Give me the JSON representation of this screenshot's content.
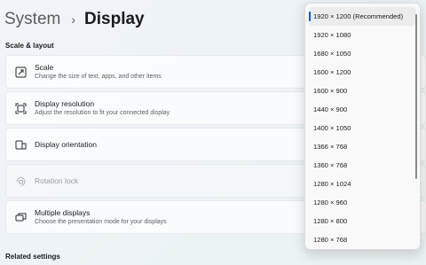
{
  "breadcrumb": {
    "parent": "System",
    "separator": "›",
    "current": "Display"
  },
  "sections": {
    "scale_layout": "Scale & layout",
    "related": "Related settings"
  },
  "cards": [
    {
      "title": "Scale",
      "subtitle": "Change the size of text, apps, and other items",
      "icon": "scale-icon"
    },
    {
      "title": "Display resolution",
      "subtitle": "Adjust the resolution to fit your connected display",
      "icon": "resolution-icon"
    },
    {
      "title": "Display orientation",
      "subtitle": "",
      "icon": "orientation-icon"
    },
    {
      "title": "Rotation lock",
      "subtitle": "",
      "icon": "rotation-lock-icon",
      "disabled": true
    },
    {
      "title": "Multiple displays",
      "subtitle": "Choose the presentation mode for your displays",
      "icon": "multiple-displays-icon"
    }
  ],
  "resolution_dropdown": {
    "selected_index": 0,
    "options": [
      "1920 × 1200 (Recommended)",
      "1920 × 1080",
      "1680 × 1050",
      "1600 × 1200",
      "1600 × 900",
      "1440 × 900",
      "1400 × 1050",
      "1366 × 768",
      "1360 × 768",
      "1280 × 1024",
      "1280 × 960",
      "1280 × 800",
      "1280 × 768"
    ]
  },
  "colors": {
    "accent": "#005fb8",
    "card_bg": "#fbfcfd",
    "text": "#1b1b1b",
    "secondary_text": "#5f5f5f"
  }
}
